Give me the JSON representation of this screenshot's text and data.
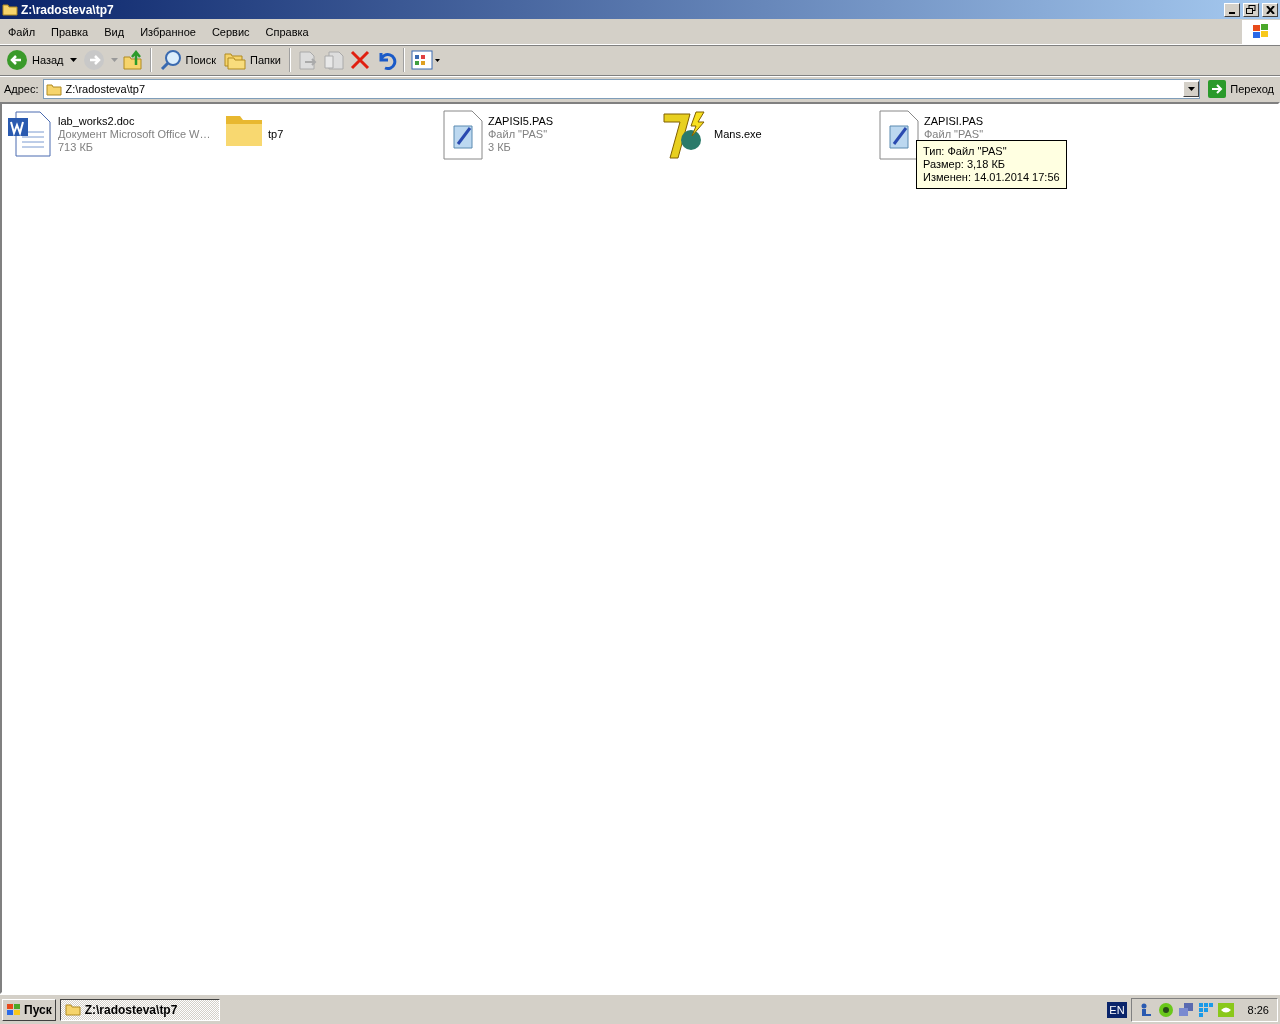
{
  "window": {
    "title": "Z:\\radosteva\\tp7"
  },
  "menu": [
    "Файл",
    "Правка",
    "Вид",
    "Избранное",
    "Сервис",
    "Справка"
  ],
  "toolbar": {
    "back": "Назад",
    "search": "Поиск",
    "folders": "Папки"
  },
  "address": {
    "label": "Адрес:",
    "value": "Z:\\radosteva\\tp7",
    "go": "Переход"
  },
  "files": [
    {
      "kind": "doc",
      "name": "lab_works2.doc",
      "type": "Документ Microsoft Office W…",
      "size": "713 КБ"
    },
    {
      "kind": "folder",
      "name": "tp7"
    },
    {
      "kind": "pas",
      "name": "ZAPISI5.PAS",
      "type": "Файл \"PAS\"",
      "size": "3 КБ"
    },
    {
      "kind": "exe",
      "name": "Mans.exe"
    },
    {
      "kind": "pas",
      "name": "ZAPISI.PAS",
      "type": "Файл \"PAS\""
    }
  ],
  "tooltip": {
    "lines": [
      "Тип: Файл \"PAS\"",
      "Размер: 3,18 КБ",
      "Изменен: 14.01.2014 17:56"
    ]
  },
  "taskbar": {
    "start": "Пуск",
    "tasks": [
      {
        "label": "Z:\\radosteva\\tp7",
        "selected": true
      }
    ],
    "language": "EN",
    "clock": "8:26"
  }
}
